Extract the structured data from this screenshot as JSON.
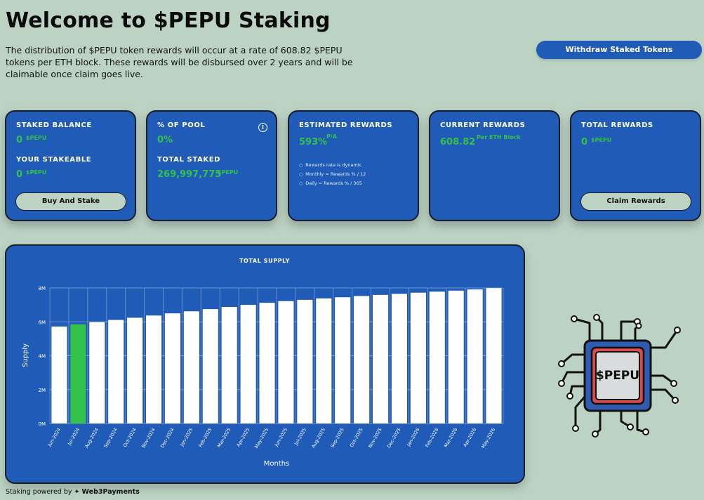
{
  "header": {
    "title": "Welcome to $PEPU Staking",
    "intro": "The distribution of $PEPU token rewards will occur at a rate of 608.82 $PEPU tokens per ETH block. These rewards will be disbursed over 2 years and will be claimable once claim goes live.",
    "withdraw_label": "Withdraw Staked Tokens"
  },
  "cards": {
    "staked_balance": {
      "label": "STAKED BALANCE",
      "value": "0",
      "unit": "$PEPU"
    },
    "your_stakeable": {
      "label": "YOUR STAKEABLE",
      "value": "0",
      "unit": "$PEPU",
      "button": "Buy And Stake"
    },
    "pool": {
      "label": "% OF POOL",
      "value": "0%",
      "info": "i"
    },
    "total_staked": {
      "label": "TOTAL STAKED",
      "value": "269,997,775",
      "unit": "$PEPU"
    },
    "estimated": {
      "label": "ESTIMATED REWARDS",
      "value": "593%",
      "unit": "P/A",
      "notes": [
        "Rewards rate is dynamic",
        "Monthly = Rewards % / 12",
        "Daily = Rewards % / 365"
      ]
    },
    "current": {
      "label": "CURRENT REWARDS",
      "value": "608.82",
      "unit": "Per ETH Block"
    },
    "total_rewards": {
      "label": "TOTAL REWARDS",
      "value": "0",
      "unit": "$PEPU",
      "button": "Claim Rewards"
    }
  },
  "colors": {
    "accent": "#215bb8",
    "green": "#33c24a",
    "bar": "#ffffff",
    "background": "#bcd3c3"
  },
  "chart_data": {
    "type": "bar",
    "title": "TOTAL SUPPLY",
    "xlabel": "Months",
    "ylabel": "Supply",
    "ylim": [
      0,
      8
    ],
    "yticks": [
      "0M",
      "2M",
      "4M",
      "6M",
      "8M"
    ],
    "categories": [
      "Jun-2024",
      "Jul-2024",
      "Aug-2024",
      "Sep-2024",
      "Oct-2024",
      "Nov-2024",
      "Dec-2024",
      "Jan-2025",
      "Feb-2025",
      "Mar-2025",
      "Apr-2025",
      "May-2025",
      "Jun-2025",
      "Jul-2025",
      "Aug-2025",
      "Sep-2025",
      "Oct-2025",
      "Nov-2025",
      "Dec-2025",
      "Jan-2026",
      "Feb-2026",
      "Mar-2026",
      "Apr-2026",
      "May-2026"
    ],
    "values": [
      5.72,
      5.85,
      5.98,
      6.11,
      6.24,
      6.37,
      6.5,
      6.62,
      6.75,
      6.88,
      7.0,
      7.12,
      7.22,
      7.3,
      7.38,
      7.45,
      7.52,
      7.59,
      7.65,
      7.72,
      7.78,
      7.84,
      7.91,
      7.99
    ],
    "highlight_index": 1,
    "grid": true
  },
  "mascot": {
    "label": "$PEPU"
  },
  "footer": {
    "prefix": "Staking powered by",
    "brand": "Web3Payments"
  }
}
